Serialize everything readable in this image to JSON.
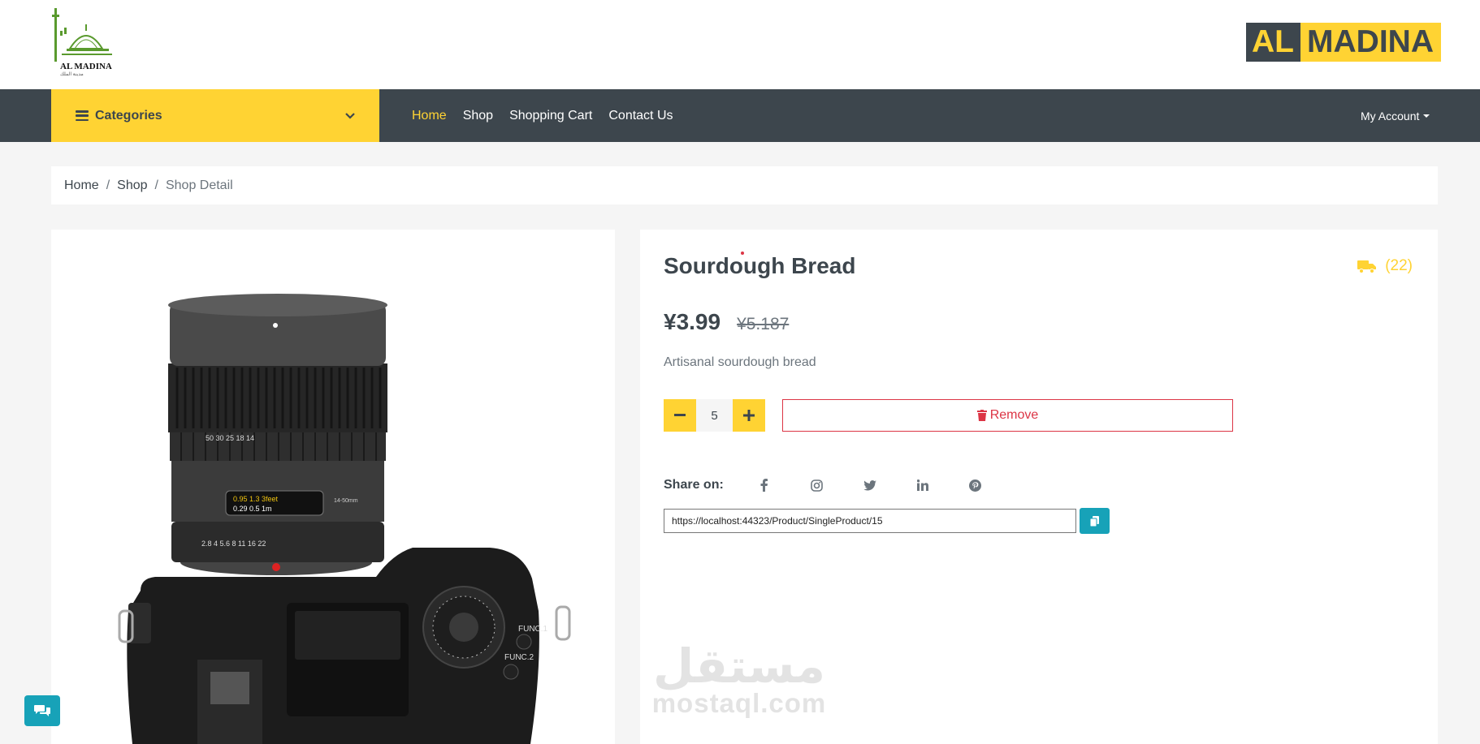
{
  "header": {
    "logo_text": "AL MADINA",
    "logo_sub": "مدينة الملك",
    "brand_part1": "AL",
    "brand_part2": "MADINA"
  },
  "navbar": {
    "categories_label": "Categories",
    "links": [
      "Home",
      "Shop",
      "Shopping Cart",
      "Contact Us"
    ],
    "active_link": "Home",
    "account_label": "My Account"
  },
  "breadcrumb": {
    "items": [
      "Home",
      "Shop"
    ],
    "current": "Shop Detail"
  },
  "product": {
    "title": "Sourdough Bread",
    "reviews_count": "(22)",
    "price": "¥3.99",
    "old_price": "¥5.187",
    "description": "Artisanal sourdough bread",
    "quantity": "5",
    "remove_label": "Remove",
    "image_alt": "camera"
  },
  "share": {
    "label": "Share on:",
    "icons": [
      "facebook-icon",
      "instagram-icon",
      "twitter-icon",
      "linkedin-icon",
      "pinterest-icon"
    ],
    "url": "https://localhost:44323/Product/SingleProduct/15"
  },
  "watermark": {
    "arabic": "مستقل",
    "latin": "mostaql.com"
  },
  "colors": {
    "accent": "#ffd333",
    "dark": "#3d464d",
    "danger": "#dc3545",
    "info": "#17a2b8"
  }
}
